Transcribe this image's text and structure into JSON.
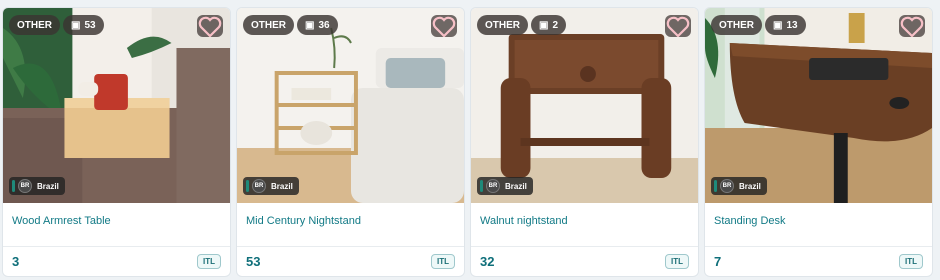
{
  "colors": {
    "accent": "#127a86",
    "badge_bg": "#3a3432"
  },
  "cards": [
    {
      "category": "OTHER",
      "stat_icon": "cube-icon",
      "stat": "53",
      "country_code": "BR",
      "country": "Brazil",
      "title": "Wood Armrest Table",
      "count": "3",
      "lang": "ITL"
    },
    {
      "category": "OTHER",
      "stat_icon": "cube-icon",
      "stat": "36",
      "country_code": "BR",
      "country": "Brazil",
      "title": "Mid Century Nightstand",
      "count": "53",
      "lang": "ITL"
    },
    {
      "category": "OTHER",
      "stat_icon": "cube-icon",
      "stat": "2",
      "country_code": "BR",
      "country": "Brazil",
      "title": "Walnut nightstand",
      "count": "32",
      "lang": "ITL"
    },
    {
      "category": "OTHER",
      "stat_icon": "cube-icon",
      "stat": "13",
      "country_code": "BR",
      "country": "Brazil",
      "title": "Standing Desk",
      "count": "7",
      "lang": "ITL"
    }
  ]
}
